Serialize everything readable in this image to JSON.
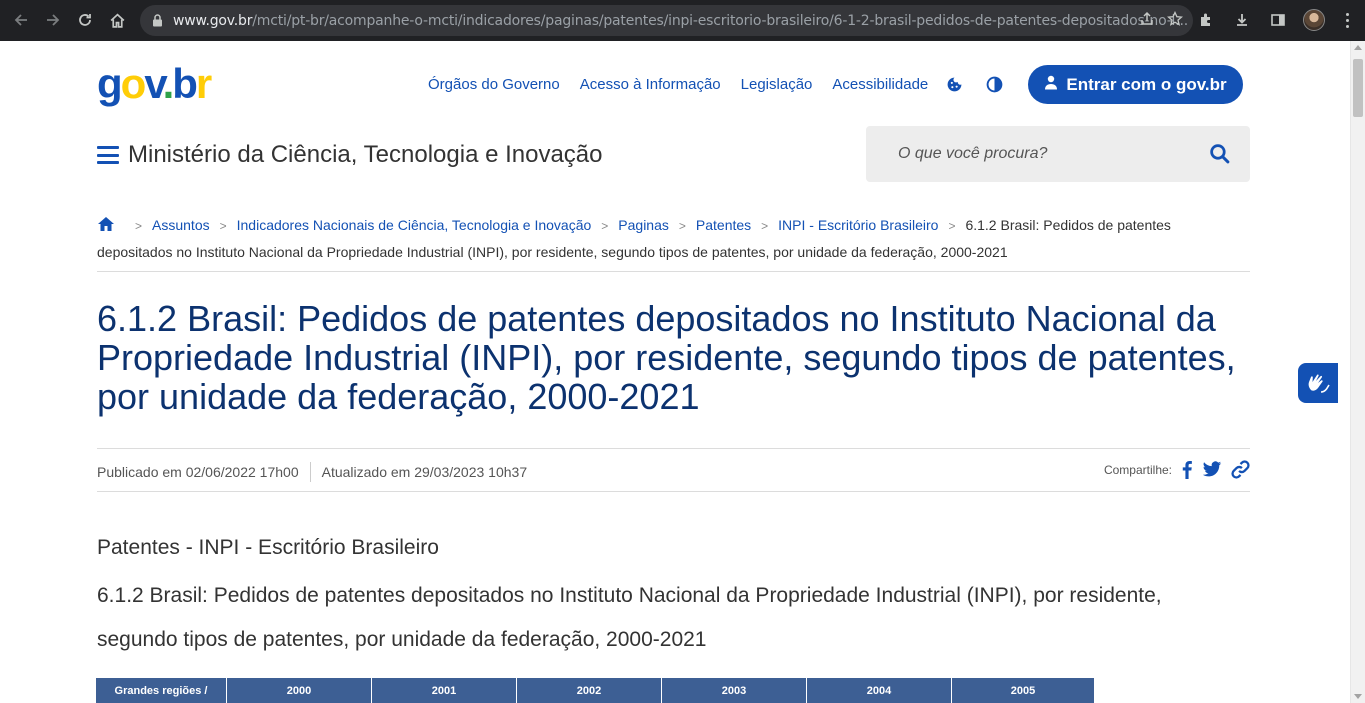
{
  "browser": {
    "url_host": "www.gov.br",
    "url_path": "/mcti/pt-br/acompanhe-o-mcti/indicadores/paginas/patentes/inpi-escritorio-brasileiro/6-1-2-brasil-pedidos-de-patentes-depositados-no-i..."
  },
  "header": {
    "logo": {
      "g": "g",
      "o": "o",
      "v": "v",
      "dot": ".",
      "b": "b",
      "r": "r"
    },
    "links": [
      "Órgãos do Governo",
      "Acesso à Informação",
      "Legislação",
      "Acessibilidade"
    ],
    "login_label": "Entrar com o  gov.br",
    "site_title": "Ministério da Ciência, Tecnologia e Inovação",
    "search_placeholder": "O que você procura?"
  },
  "breadcrumb": {
    "items": [
      "Assuntos",
      "Indicadores Nacionais de Ciência, Tecnologia e Inovação",
      "Paginas",
      "Patentes",
      "INPI - Escritório Brasileiro"
    ],
    "current": "6.1.2 Brasil: Pedidos de patentes depositados no Instituto Nacional da Propriedade Industrial (INPI), por residente, segundo tipos de patentes, por unidade da federação, 2000-2021"
  },
  "page": {
    "title": "6.1.2 Brasil: Pedidos de patentes depositados no Instituto Nacional da Propriedade Industrial (INPI), por residente, segundo tipos de patentes, por unidade da federação, 2000-2021",
    "published": "Publicado em 02/06/2022 17h00",
    "updated": "Atualizado em 29/03/2023 10h37",
    "share_label": "Compartilhe:",
    "section_title": "Patentes - INPI - Escritório Brasileiro",
    "table_caption": "6.1.2  Brasil: Pedidos de patentes depositados no Instituto Nacional da Propriedade Industrial (INPI), por residente, segundo tipos de patentes, por unidade da federação, 2000-2021"
  },
  "table": {
    "headers": [
      "Grandes regiões /",
      "2000",
      "2001",
      "2002",
      "2003",
      "2004",
      "2005"
    ]
  },
  "colors": {
    "primary": "#1351b4",
    "title": "#0c326f",
    "table_header": "#3d5f94"
  }
}
